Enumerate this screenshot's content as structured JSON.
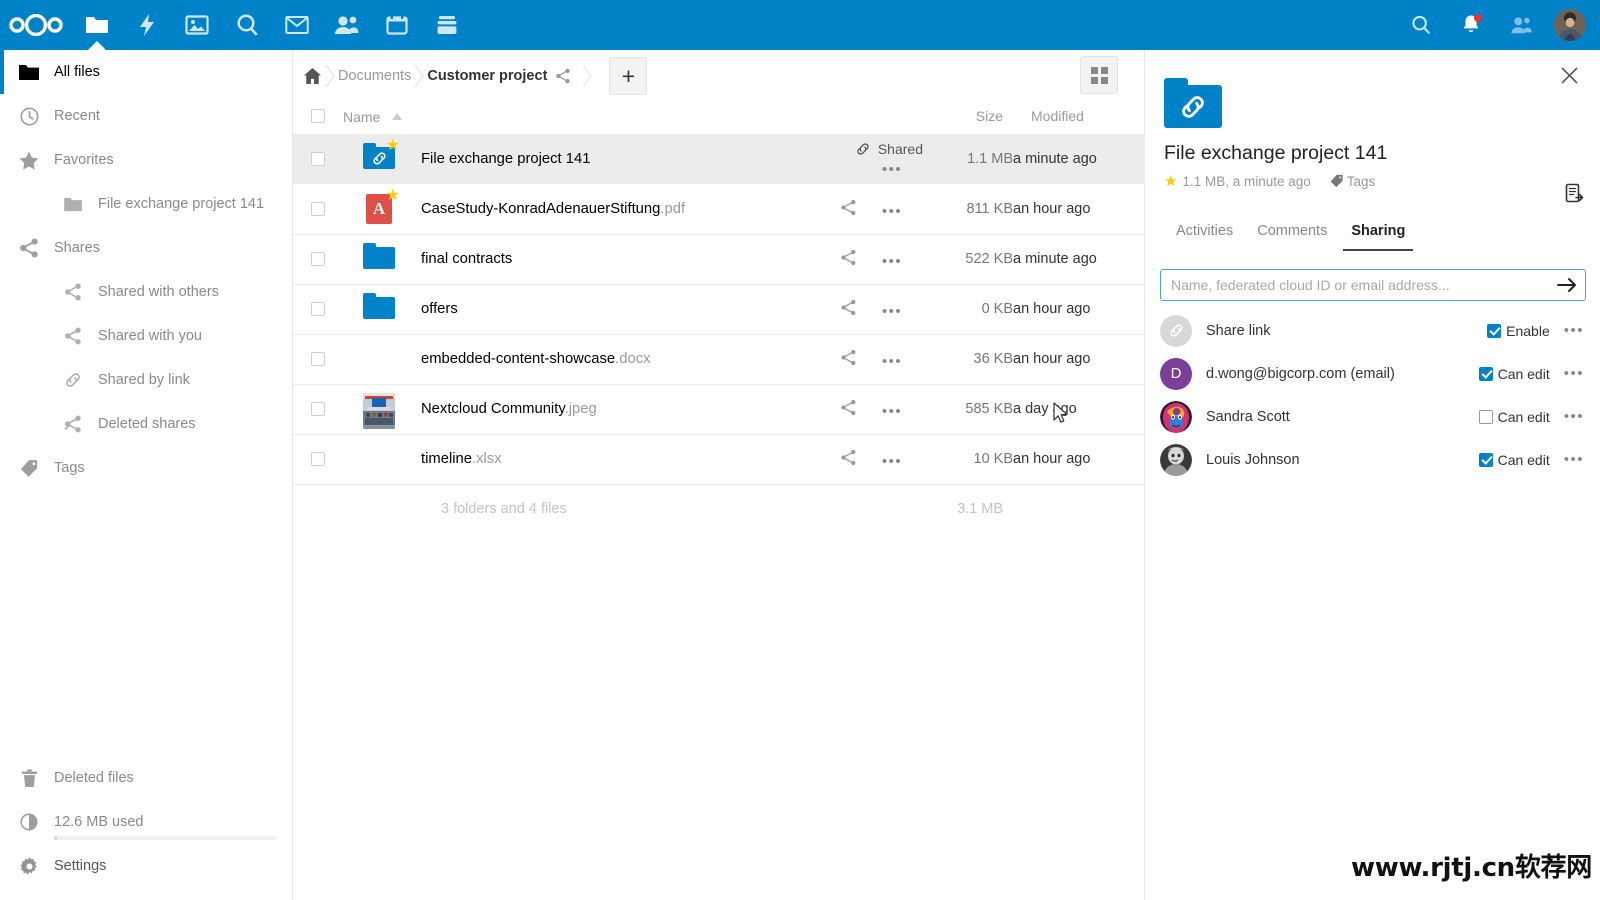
{
  "header": {
    "logo_name": "nextcloud-logo",
    "apps": [
      {
        "name": "files-app",
        "icon": "folder-icon",
        "active": true
      },
      {
        "name": "activity-app",
        "icon": "lightning-icon",
        "active": false
      },
      {
        "name": "photos-app",
        "icon": "image-icon",
        "active": false
      },
      {
        "name": "search-app",
        "icon": "magnifier-icon",
        "active": false
      },
      {
        "name": "mail-app",
        "icon": "envelope-icon",
        "active": false
      },
      {
        "name": "contacts-app",
        "icon": "people-icon",
        "active": false
      },
      {
        "name": "calendar-app",
        "icon": "calendar-icon",
        "active": false
      },
      {
        "name": "deck-app",
        "icon": "deck-icon",
        "active": false
      }
    ],
    "right_icons": [
      {
        "name": "search-icon",
        "badge": false
      },
      {
        "name": "notifications-bell-icon",
        "badge": true
      },
      {
        "name": "contacts-menu-icon",
        "badge": false
      }
    ],
    "avatar_name": "user-avatar"
  },
  "sidebar": {
    "items": [
      {
        "label": "All files",
        "icon": "folder-icon",
        "active": true,
        "level": 0
      },
      {
        "label": "Recent",
        "icon": "clock-icon",
        "active": false,
        "level": 0
      },
      {
        "label": "Favorites",
        "icon": "star-icon",
        "active": false,
        "level": 0
      },
      {
        "label": "File exchange project 141",
        "icon": "folder-icon",
        "active": false,
        "level": 1
      },
      {
        "label": "Shares",
        "icon": "share-icon",
        "active": false,
        "level": 0
      },
      {
        "label": "Shared with others",
        "icon": "share-icon",
        "active": false,
        "level": 1
      },
      {
        "label": "Shared with you",
        "icon": "share-icon",
        "active": false,
        "level": 1
      },
      {
        "label": "Shared by link",
        "icon": "link-icon",
        "active": false,
        "level": 1
      },
      {
        "label": "Deleted shares",
        "icon": "share-off-icon",
        "active": false,
        "level": 1
      },
      {
        "label": "Tags",
        "icon": "tag-icon",
        "active": false,
        "level": 0
      }
    ],
    "bottom": {
      "deleted_files": "Deleted files",
      "quota": "12.6 MB used",
      "settings": "Settings"
    }
  },
  "breadcrumb": {
    "home_icon": "home-icon",
    "items": [
      "Documents",
      "Customer project"
    ],
    "shared_icon": "share-icon",
    "new_button": "+"
  },
  "filelist": {
    "columns": {
      "name": "Name",
      "size": "Size",
      "modified": "Modified"
    },
    "sort": "ascending",
    "rows": [
      {
        "name": "File exchange project 141",
        "ext": "",
        "icon": "folder-link-icon",
        "favorite": true,
        "share_label": "Shared",
        "share_icon": "link-icon",
        "size": "1.1 MB",
        "modified": "a minute ago",
        "selected": true
      },
      {
        "name": "CaseStudy-KonradAdenauerStiftung",
        "ext": ".pdf",
        "icon": "pdf-icon",
        "favorite": true,
        "share_label": "",
        "share_icon": "share-icon",
        "size": "811 KB",
        "modified": "an hour ago",
        "selected": false
      },
      {
        "name": "final contracts",
        "ext": "",
        "icon": "folder-icon",
        "favorite": false,
        "share_label": "",
        "share_icon": "share-icon",
        "size": "522 KB",
        "modified": "a minute ago",
        "selected": false
      },
      {
        "name": "offers",
        "ext": "",
        "icon": "folder-icon",
        "favorite": false,
        "share_label": "",
        "share_icon": "share-icon",
        "size": "0 KB",
        "modified": "an hour ago",
        "selected": false
      },
      {
        "name": "embedded-content-showcase",
        "ext": ".docx",
        "icon": "docx-icon",
        "favorite": false,
        "share_label": "",
        "share_icon": "share-icon",
        "size": "36 KB",
        "modified": "an hour ago",
        "selected": false
      },
      {
        "name": "Nextcloud Community",
        "ext": ".jpeg",
        "icon": "image-thumbnail",
        "favorite": false,
        "share_label": "",
        "share_icon": "share-icon",
        "size": "585 KB",
        "modified": "a day ago",
        "selected": false
      },
      {
        "name": "timeline",
        "ext": ".xlsx",
        "icon": "xlsx-icon",
        "favorite": false,
        "share_label": "",
        "share_icon": "share-icon",
        "size": "10 KB",
        "modified": "an hour ago",
        "selected": false
      }
    ],
    "summary": {
      "counts": "3 folders and 4 files",
      "total_size": "3.1 MB"
    },
    "actions_menu": "•••",
    "grid_view_icon": "grid-view-icon"
  },
  "details": {
    "close_icon": "close-icon",
    "thumbnail_icon": "folder-link-icon",
    "title": "File exchange project 141",
    "meta": "1.1 MB, a minute ago",
    "tags_label": "Tags",
    "copy_icon": "copy-direct-link-icon",
    "tabs": [
      {
        "label": "Activities",
        "active": false
      },
      {
        "label": "Comments",
        "active": false
      },
      {
        "label": "Sharing",
        "active": true
      }
    ],
    "share_input": {
      "value": "",
      "placeholder": "Name, federated cloud ID or email address...",
      "submit_icon": "arrow-right-icon"
    },
    "shares": [
      {
        "name": "Share link",
        "avatar_type": "link",
        "avatar_letter": "",
        "avatar_color": "#d8d8d8",
        "permission_label": "Enable",
        "permission_checked": true
      },
      {
        "name": "d.wong@bigcorp.com (email)",
        "avatar_type": "letter",
        "avatar_letter": "D",
        "avatar_color": "#7b3f99",
        "permission_label": "Can edit",
        "permission_checked": true
      },
      {
        "name": "Sandra Scott",
        "avatar_type": "photo-colorful",
        "avatar_letter": "",
        "avatar_color": "#d23b8e",
        "permission_label": "Can edit",
        "permission_checked": false
      },
      {
        "name": "Louis Johnson",
        "avatar_type": "photo-gray",
        "avatar_letter": "",
        "avatar_color": "#8e8e8e",
        "permission_label": "Can edit",
        "permission_checked": true
      }
    ],
    "row_menu": "•••"
  },
  "watermark": "www.rjtj.cn软荐网",
  "colors": {
    "brand": "#0082c9",
    "accent_star": "#ffcc00",
    "selected_row": "#ececec",
    "notification": "#e9322d"
  }
}
